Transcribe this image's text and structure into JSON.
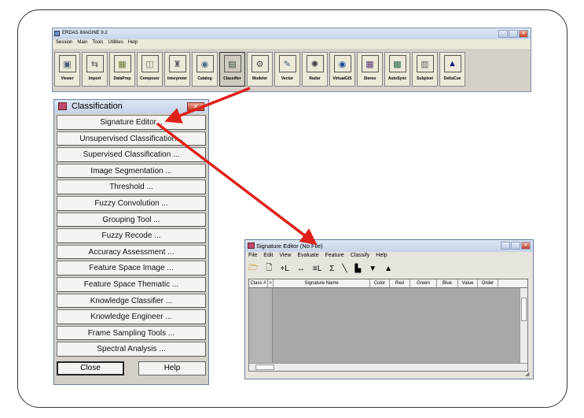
{
  "erdas": {
    "title": "ERDAS IMAGINE 9.2",
    "menu": [
      "Session",
      "Main",
      "Tools",
      "Utilities",
      "Help"
    ],
    "tools": [
      {
        "label": "Viewer",
        "icon": "viewer-icon",
        "glyph": "▣",
        "color": "#4a5a7a"
      },
      {
        "label": "Import",
        "icon": "import-icon",
        "glyph": "⇆",
        "color": "#5a5a5a"
      },
      {
        "label": "DataPrep",
        "icon": "dataprep-icon",
        "glyph": "▦",
        "color": "#6a7a3a"
      },
      {
        "label": "Composer",
        "icon": "composer-icon",
        "glyph": "◫",
        "color": "#7a6a5a"
      },
      {
        "label": "Interpreter",
        "icon": "interpreter-icon",
        "glyph": "♜",
        "color": "#5a5a5a"
      },
      {
        "label": "Catalog",
        "icon": "catalog-icon",
        "glyph": "◉",
        "color": "#4a6a8a"
      },
      {
        "label": "Classifier",
        "icon": "classifier-icon",
        "glyph": "▤",
        "color": "#3a4a3a",
        "pressed": true
      },
      {
        "label": "Modeler",
        "icon": "modeler-icon",
        "glyph": "⚙",
        "color": "#4a4a4a"
      },
      {
        "label": "Vector",
        "icon": "vector-icon",
        "glyph": "✎",
        "color": "#3a5a7a"
      },
      {
        "label": "Radar",
        "icon": "radar-icon",
        "glyph": "✺",
        "color": "#3a3a3a"
      },
      {
        "label": "VirtualGIS",
        "icon": "virtualgis-icon",
        "glyph": "◉",
        "color": "#1a4a9a"
      },
      {
        "label": "Stereo",
        "icon": "stereo-icon",
        "glyph": "▦",
        "color": "#5a3a7a"
      },
      {
        "label": "AutoSync",
        "icon": "autosync-icon",
        "glyph": "▩",
        "color": "#2a6a4a"
      },
      {
        "label": "Subpixel",
        "icon": "subpixel-icon",
        "glyph": "▥",
        "color": "#5a5a5a"
      },
      {
        "label": "DeltaCue",
        "icon": "deltacue-icon",
        "glyph": "▲",
        "color": "#1a1a8a"
      }
    ]
  },
  "classification": {
    "title": "Classification",
    "buttons": [
      "Signature Editor...",
      "Unsupervised Classification...",
      "Supervised Classification ...",
      "Image Segmentation ...",
      "Threshold ...",
      "Fuzzy Convolution ...",
      "Grouping Tool ...",
      "Fuzzy Recode ...",
      "Accuracy Assessment ...",
      "Feature Space Image ...",
      "Feature Space Thematic ...",
      "Knowledge Classifier ...",
      "Knowledge Engineer ...",
      "Frame Sampling Tools ...",
      "Spectral Analysis ..."
    ],
    "close_label": "Close",
    "help_label": "Help"
  },
  "signature_editor": {
    "title": "Signature Editor (No File)",
    "menu": [
      "File",
      "Edit",
      "View",
      "Evaluate",
      "Feature",
      "Classify",
      "Help"
    ],
    "columns": [
      "Class #",
      ">",
      "Signature Name",
      "Color",
      "Red",
      "Green",
      "Blue",
      "Value",
      "Order"
    ]
  },
  "colors": {
    "arrow": "#e0201a",
    "panel_bg": "#d4d0c8",
    "table_bg": "#a8a8a8"
  }
}
